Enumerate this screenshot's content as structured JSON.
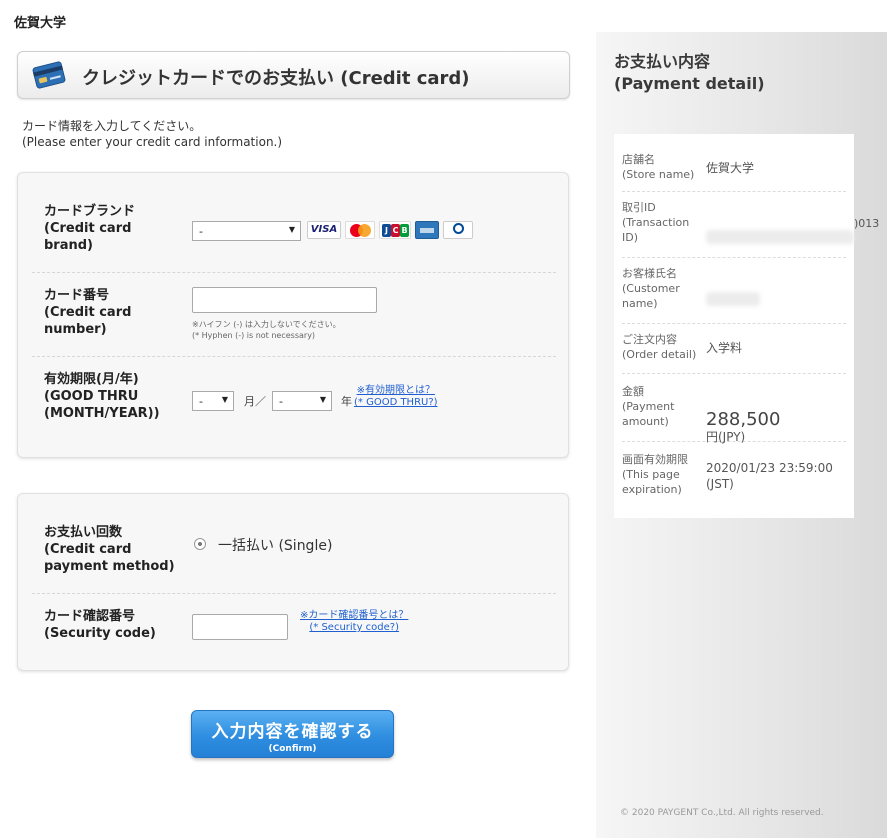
{
  "site": {
    "title": "佐賀大学"
  },
  "header": {
    "title": "クレジットカードでのお支払い (Credit card)",
    "icon": "credit-card-icon"
  },
  "intro": {
    "line1": "カード情報を入力してください。",
    "line2": "(Please enter your credit card information.)"
  },
  "form": {
    "brand": {
      "label": "カードブランド\n(Credit card\nbrand)",
      "selected": "-",
      "brands": [
        "VISA",
        "mastercard",
        "JCB",
        "AMERICAN EXPRESS",
        "Diners Club"
      ]
    },
    "number": {
      "label": "カード番号\n(Credit card\nnumber)",
      "value": "",
      "note": "※ハイフン (-) は入力しないでください。\n(* Hyphen (-) is not necessary)"
    },
    "expiry": {
      "label": "有効期限(月/年)\n(GOOD THRU\n(MONTH/YEAR))",
      "month_selected": "-",
      "month_unit": "月／",
      "year_selected": "-",
      "year_unit": "年",
      "help_link": "※有効期限とは？\n(* GOOD THRU?)"
    },
    "payment_method": {
      "label": "お支払い回数\n(Credit card\npayment method)",
      "option": "一括払い (Single)",
      "selected": true
    },
    "security": {
      "label": "カード確認番号\n(Security code)",
      "value": "",
      "help_link": "※カード確認番号とは？\n(* Security code?)"
    }
  },
  "confirm": {
    "label": "入力内容を確認する",
    "sub": "(Confirm)"
  },
  "detail": {
    "title_ja": "お支払い内容",
    "title_en": "(Payment detail)",
    "rows": [
      {
        "label": "店舗名\n(Store name)",
        "value": "佐賀大学"
      },
      {
        "label": "取引ID\n(Transaction\nID)",
        "value": ")013"
      },
      {
        "label": "お客様氏名\n(Customer\nname)",
        "value": ""
      },
      {
        "label": "ご注文内容\n(Order detail)",
        "value": "入学料"
      },
      {
        "label": "金額\n(Payment\namount)",
        "value": "288,500",
        "unit": "円(JPY)"
      },
      {
        "label": "画面有効期限\n(This page\nexpiration)",
        "value": "2020/01/23 23:59:00\n(JST)"
      }
    ]
  },
  "footer": {
    "text": "© 2020 PAYGENT Co.,Ltd. All rights reserved."
  }
}
